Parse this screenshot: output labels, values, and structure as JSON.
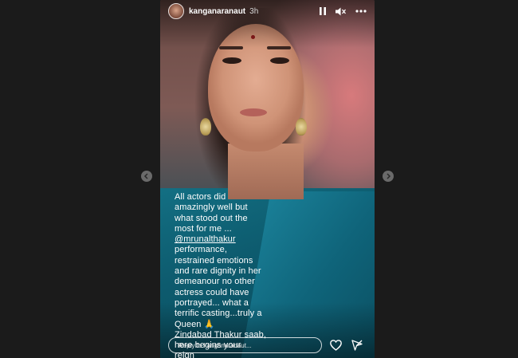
{
  "story": {
    "username": "kanganaranaut",
    "time": "3h",
    "caption_pre": "All actors did\namazingly well but\nwhat stood out the\nmost for me ...",
    "mention": "@mrunalthakur",
    "caption_post": "performance,\nrestrained emotions\nand rare dignity in her\ndemeanour no other\nactress could have\nportrayed... what a\nterrific casting...truly a\nQueen 🙏\nZindabad Thakur saab,\nhere begins your\nreign\n#sitaramam",
    "reply_placeholder": "Reply to kanganaranaut..."
  },
  "icons": {
    "pause": "pause-icon",
    "mute": "mute-icon",
    "more": "more-icon",
    "heart": "heart-icon",
    "send": "send-icon",
    "prev": "chevron-left-icon",
    "next": "chevron-right-icon"
  },
  "colors": {
    "background": "#1b1b1b",
    "text": "#ffffff",
    "saree": "#136f83"
  }
}
